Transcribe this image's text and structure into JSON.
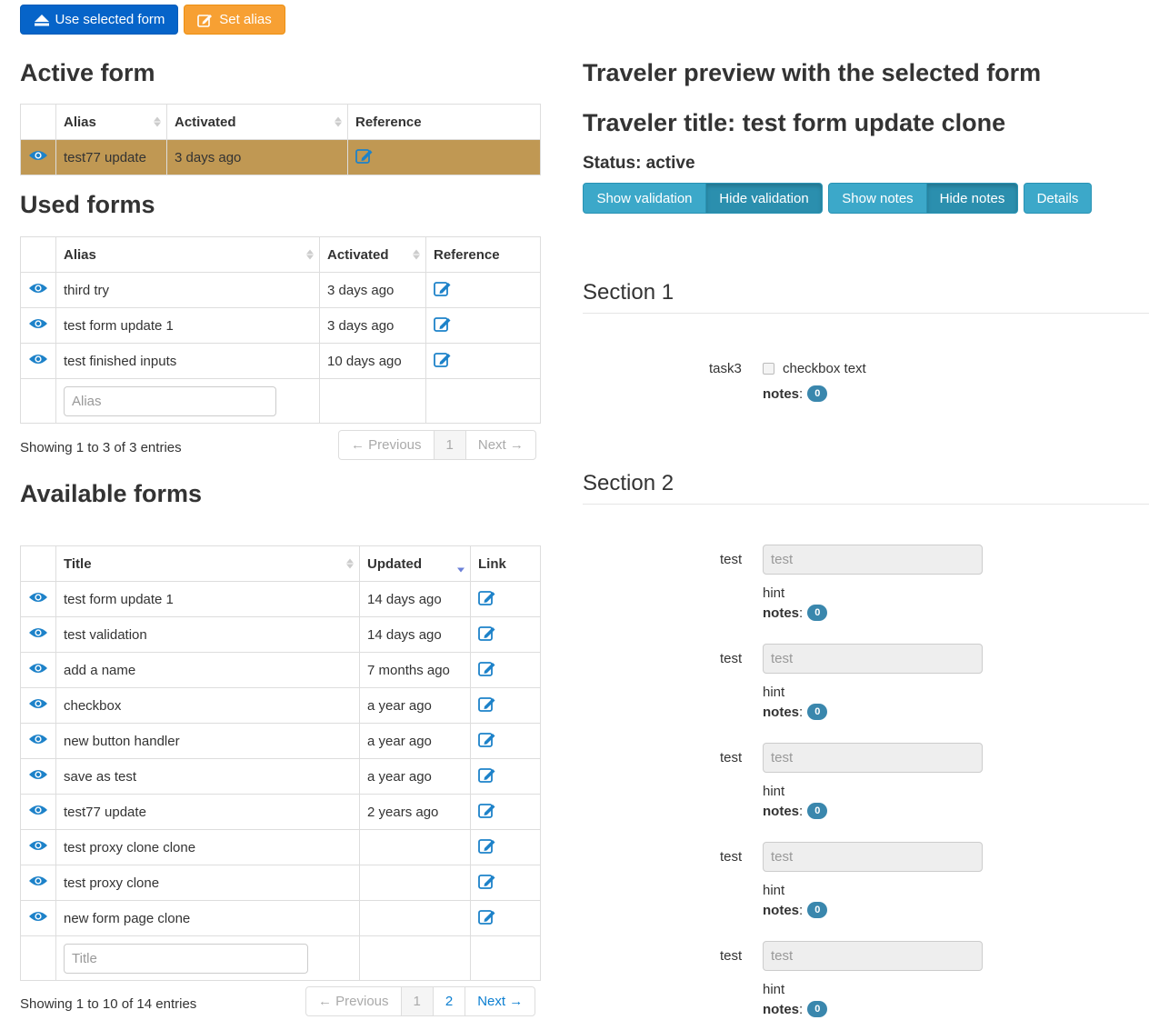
{
  "toolbar": {
    "use_selected_label": "Use selected form",
    "set_alias_label": "Set alias"
  },
  "active_form": {
    "heading": "Active form",
    "columns": [
      "Alias",
      "Activated",
      "Reference"
    ],
    "row": {
      "alias": "test77 update",
      "activated": "3 days ago"
    }
  },
  "used_forms": {
    "heading": "Used forms",
    "columns": [
      "Alias",
      "Activated",
      "Reference"
    ],
    "rows": [
      {
        "alias": "third try",
        "activated": "3 days ago"
      },
      {
        "alias": "test form update 1",
        "activated": "3 days ago"
      },
      {
        "alias": "test finished inputs",
        "activated": "10 days ago"
      }
    ],
    "filter_placeholder": "Alias",
    "info": "Showing 1 to 3 of 3 entries",
    "pager": {
      "prev": "← Previous",
      "pages": [
        "1"
      ],
      "next": "Next →"
    }
  },
  "available_forms": {
    "heading": "Available forms",
    "columns": [
      "Title",
      "Updated",
      "Link"
    ],
    "rows": [
      {
        "title": "test form update 1",
        "updated": "14 days ago"
      },
      {
        "title": "test validation",
        "updated": "14 days ago"
      },
      {
        "title": "add a name",
        "updated": "7 months ago"
      },
      {
        "title": "checkbox",
        "updated": "a year ago"
      },
      {
        "title": "new button handler",
        "updated": "a year ago"
      },
      {
        "title": "save as test",
        "updated": "a year ago"
      },
      {
        "title": "test77 update",
        "updated": "2 years ago"
      },
      {
        "title": "test proxy clone clone",
        "updated": ""
      },
      {
        "title": "test proxy clone",
        "updated": ""
      },
      {
        "title": "new form page clone",
        "updated": ""
      }
    ],
    "filter_placeholder": "Title",
    "info": "Showing 1 to 10 of 14 entries",
    "pager": {
      "prev": "← Previous",
      "pages": [
        "1",
        "2"
      ],
      "next": "Next →"
    }
  },
  "preview": {
    "heading": "Traveler preview with the selected form",
    "traveler_title": "Traveler title: test form update clone",
    "status": "Status: active",
    "buttons": {
      "show_validation": "Show validation",
      "hide_validation": "Hide validation",
      "show_notes": "Show notes",
      "hide_notes": "Hide notes",
      "details": "Details"
    },
    "section1": {
      "title": "Section 1",
      "task_label": "task3",
      "checkbox_text": "checkbox text",
      "notes_label": "notes",
      "notes_count": "0"
    },
    "section2": {
      "title": "Section 2",
      "fields": [
        {
          "label": "test",
          "placeholder": "test",
          "hint": "hint",
          "notes_label": "notes",
          "notes_count": "0"
        },
        {
          "label": "test",
          "placeholder": "test",
          "hint": "hint",
          "notes_label": "notes",
          "notes_count": "0"
        },
        {
          "label": "test",
          "placeholder": "test",
          "hint": "hint",
          "notes_label": "notes",
          "notes_count": "0"
        },
        {
          "label": "test",
          "placeholder": "test",
          "hint": "hint",
          "notes_label": "notes",
          "notes_count": "0"
        },
        {
          "label": "test",
          "placeholder": "test",
          "hint": "hint",
          "notes_label": "notes",
          "notes_count": "0"
        }
      ]
    }
  },
  "colors": {
    "primary": "#0664c9",
    "warning": "#f7a033",
    "info": "#3ca8c9",
    "highlight_row": "#c09853",
    "link": "#0c7fd1",
    "badge": "#3a87ad"
  }
}
